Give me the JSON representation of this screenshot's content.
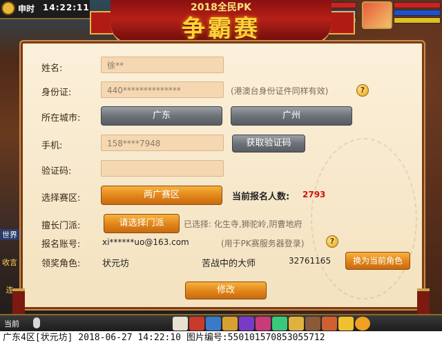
{
  "hud": {
    "clock_label": "申时",
    "clock_time": "14:22:11",
    "side_channel_world": "世界",
    "side_collect": "收言",
    "side_connect": "连",
    "bottom_now": "当前"
  },
  "banner": {
    "subtitle": "2018全民PK",
    "title": "争霸赛"
  },
  "form": {
    "name_label": "姓名:",
    "name_value": "徐**",
    "id_label": "身份证:",
    "id_value": "440**************",
    "id_note": "(港澳台身份证件同样有效)",
    "city_label": "所在城市:",
    "province_value": "广东",
    "city_value": "广州",
    "phone_label": "手机:",
    "phone_value": "158****7948",
    "get_code_button": "获取验证码",
    "code_label": "验证码:",
    "code_value": "",
    "zone_label": "选择赛区:",
    "zone_value": "两广赛区",
    "count_label": "当前报名人数:",
    "count_value": "2793",
    "school_label": "擅长门派:",
    "school_button": "请选择门派",
    "school_selected": "已选择: 化生寺,狮驼岭,阴曹地府",
    "account_label": "报名账号:",
    "account_value": "xi******uo@163.com",
    "account_note": "(用于PK赛服务器登录)",
    "role_label": "领奖角色:",
    "role_name": "状元坊",
    "role_title": "苦战中的大师",
    "role_id": "32761165",
    "switch_role_button": "换为当前角色",
    "modify_button": "修改",
    "help_glyph": "?"
  },
  "footer": {
    "text": "广东4区[状元坊] 2018-06-27 14:22:10 图片编号:550101570853055712"
  },
  "colors": {
    "panel_bg": "#fbf0da",
    "field_bg": "#f5d8b2",
    "orange_button": "#e0841a",
    "grey_button": "#6d7378",
    "count_red": "#d01010",
    "banner_red": "#b52018",
    "banner_gold": "#ffd23a"
  },
  "icons": [
    "sun-icon",
    "mic-icon",
    "help-icon",
    "portrait-icon",
    "dragon-decoration"
  ]
}
